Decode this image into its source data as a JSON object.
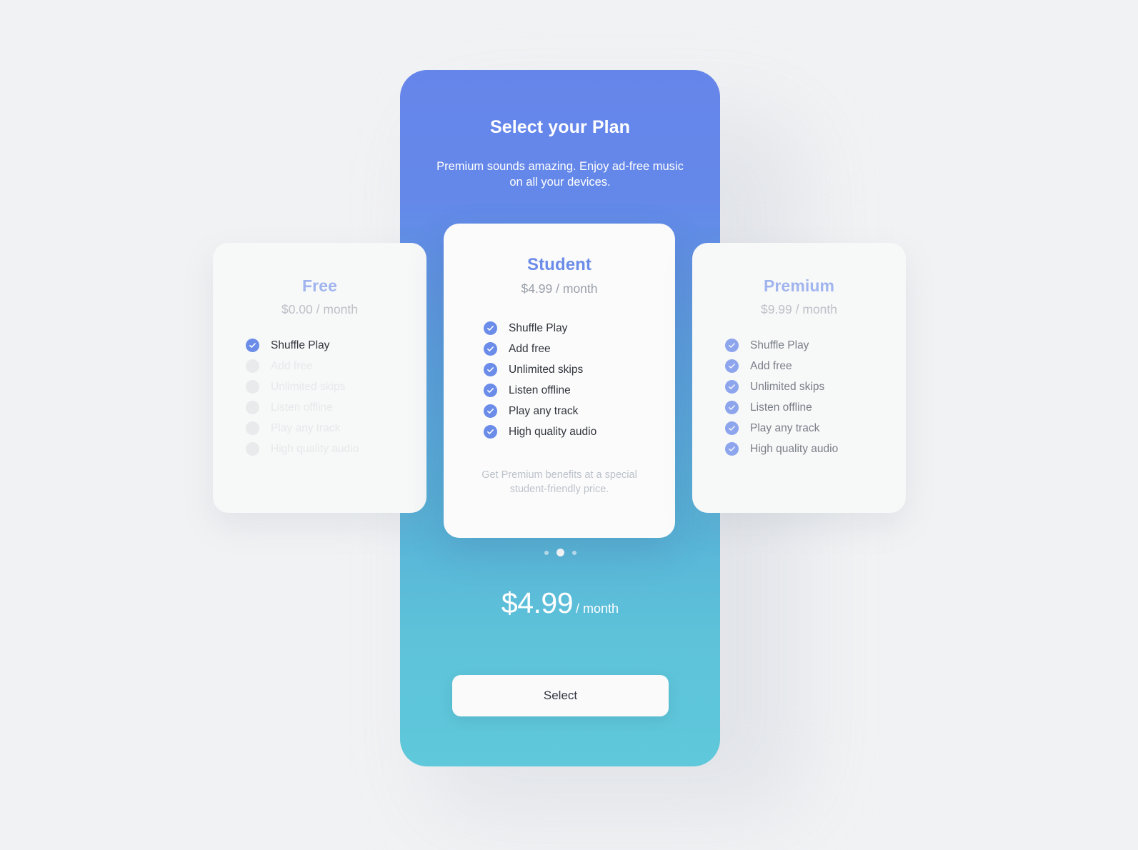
{
  "theme": {
    "page_background": "#f1f2f4",
    "gradient_top": "#6685ea",
    "gradient_bottom": "#5fc8da",
    "accent_blue": "#6b8ce8",
    "card_background": "#f7f8f8",
    "muted_text": "#9aa0aa"
  },
  "header": {
    "title": "Select your Plan",
    "subtitle": "Premium sounds amazing. Enjoy ad-free music on all your devices."
  },
  "plans": [
    {
      "name": "Free",
      "price": "$0.00 / month",
      "note": "",
      "features": [
        {
          "label": "Shuffle Play",
          "included": true
        },
        {
          "label": "Add free",
          "included": false
        },
        {
          "label": "Unlimited skips",
          "included": false
        },
        {
          "label": "Listen offline",
          "included": false
        },
        {
          "label": "Play any track",
          "included": false
        },
        {
          "label": "High quality audio",
          "included": false
        }
      ]
    },
    {
      "name": "Student",
      "price": "$4.99 / month",
      "note": "Get Premium benefits at a special student-friendly price.",
      "features": [
        {
          "label": "Shuffle Play",
          "included": true
        },
        {
          "label": "Add free",
          "included": true
        },
        {
          "label": "Unlimited skips",
          "included": true
        },
        {
          "label": "Listen offline",
          "included": true
        },
        {
          "label": "Play any track",
          "included": true
        },
        {
          "label": "High quality audio",
          "included": true
        }
      ]
    },
    {
      "name": "Premium",
      "price": "$9.99 / month",
      "note": "",
      "features": [
        {
          "label": "Shuffle Play",
          "included": true
        },
        {
          "label": "Add free",
          "included": true
        },
        {
          "label": "Unlimited skips",
          "included": true
        },
        {
          "label": "Listen offline",
          "included": true
        },
        {
          "label": "Play any track",
          "included": true
        },
        {
          "label": "High quality audio",
          "included": true
        }
      ]
    }
  ],
  "carousel": {
    "dot_count": 3,
    "active_index": 1
  },
  "summary": {
    "amount": "$4.99",
    "period": "/ month"
  },
  "actions": {
    "select_label": "Select"
  },
  "icons": {
    "check": "check-icon"
  }
}
